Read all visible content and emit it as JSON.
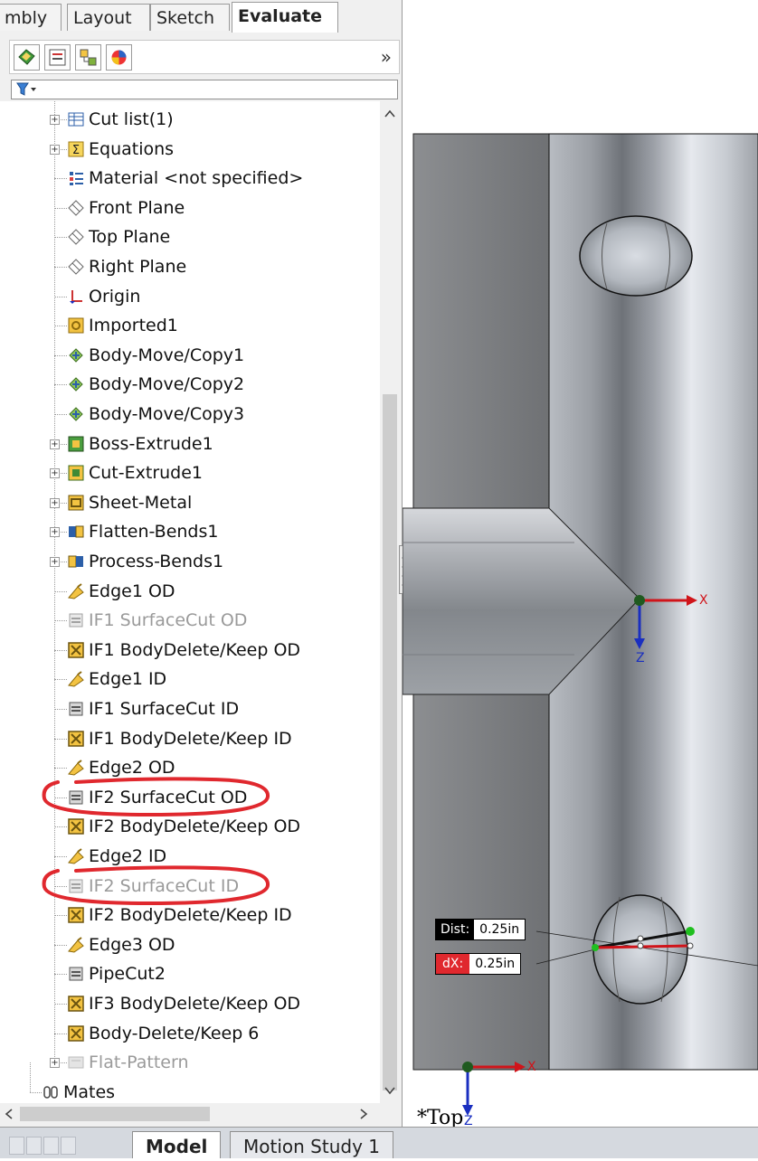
{
  "command_manager": {
    "tabs": [
      "mbly",
      "Layout",
      "Sketch",
      "Evaluate"
    ],
    "active_tab": "Evaluate",
    "expand_label": "»"
  },
  "feature_manager": {
    "toolbar_icons": [
      "feature-manager-tree-icon",
      "property-manager-icon",
      "configuration-manager-icon",
      "display-manager-icon"
    ],
    "tree": [
      {
        "label": "Cut list(1)",
        "icon": "cut-list-icon",
        "expandable": true,
        "dimmed": false
      },
      {
        "label": "Equations",
        "icon": "equations-icon",
        "expandable": true,
        "dimmed": false
      },
      {
        "label": "Material <not specified>",
        "icon": "material-icon",
        "expandable": false,
        "dimmed": false
      },
      {
        "label": "Front Plane",
        "icon": "plane-icon",
        "expandable": false,
        "dimmed": false
      },
      {
        "label": "Top Plane",
        "icon": "plane-icon",
        "expandable": false,
        "dimmed": false
      },
      {
        "label": "Right Plane",
        "icon": "plane-icon",
        "expandable": false,
        "dimmed": false
      },
      {
        "label": "Origin",
        "icon": "origin-icon",
        "expandable": false,
        "dimmed": false
      },
      {
        "label": "Imported1",
        "icon": "imported-body-icon",
        "expandable": false,
        "dimmed": false
      },
      {
        "label": "Body-Move/Copy1",
        "icon": "body-move-icon",
        "expandable": false,
        "dimmed": false
      },
      {
        "label": "Body-Move/Copy2",
        "icon": "body-move-icon",
        "expandable": false,
        "dimmed": false
      },
      {
        "label": "Body-Move/Copy3",
        "icon": "body-move-icon",
        "expandable": false,
        "dimmed": false
      },
      {
        "label": "Boss-Extrude1",
        "icon": "boss-extrude-icon",
        "expandable": true,
        "dimmed": false
      },
      {
        "label": "Cut-Extrude1",
        "icon": "cut-extrude-icon",
        "expandable": true,
        "dimmed": false
      },
      {
        "label": "Sheet-Metal",
        "icon": "sheet-metal-icon",
        "expandable": true,
        "dimmed": false
      },
      {
        "label": "Flatten-Bends1",
        "icon": "flatten-bends-icon",
        "expandable": true,
        "dimmed": false
      },
      {
        "label": "Process-Bends1",
        "icon": "process-bends-icon",
        "expandable": true,
        "dimmed": false
      },
      {
        "label": "Edge1 OD",
        "icon": "edge-icon",
        "expandable": false,
        "dimmed": false
      },
      {
        "label": "IF1 SurfaceCut OD",
        "icon": "surface-cut-icon",
        "expandable": false,
        "dimmed": true
      },
      {
        "label": "IF1 BodyDelete/Keep  OD",
        "icon": "body-delete-icon",
        "expandable": false,
        "dimmed": false
      },
      {
        "label": "Edge1 ID",
        "icon": "edge-icon",
        "expandable": false,
        "dimmed": false
      },
      {
        "label": "IF1 SurfaceCut ID",
        "icon": "surface-cut-icon",
        "expandable": false,
        "dimmed": false
      },
      {
        "label": "IF1 BodyDelete/Keep  ID",
        "icon": "body-delete-icon",
        "expandable": false,
        "dimmed": false
      },
      {
        "label": "Edge2 OD",
        "icon": "edge-icon",
        "expandable": false,
        "dimmed": false
      },
      {
        "label": "IF2 SurfaceCut OD",
        "icon": "surface-cut-icon",
        "expandable": false,
        "dimmed": false,
        "circled": true
      },
      {
        "label": "IF2 BodyDelete/Keep  OD",
        "icon": "body-delete-icon",
        "expandable": false,
        "dimmed": false
      },
      {
        "label": "Edge2 ID",
        "icon": "edge-icon",
        "expandable": false,
        "dimmed": false
      },
      {
        "label": "IF2 SurfaceCut ID",
        "icon": "surface-cut-icon",
        "expandable": false,
        "dimmed": true,
        "circled": true
      },
      {
        "label": "IF2 BodyDelete/Keep  ID",
        "icon": "body-delete-icon",
        "expandable": false,
        "dimmed": false
      },
      {
        "label": "Edge3 OD",
        "icon": "edge-icon",
        "expandable": false,
        "dimmed": false
      },
      {
        "label": "PipeCut2",
        "icon": "surface-cut-icon",
        "expandable": false,
        "dimmed": false
      },
      {
        "label": "IF3 BodyDelete/Keep  OD",
        "icon": "body-delete-icon",
        "expandable": false,
        "dimmed": false
      },
      {
        "label": "Body-Delete/Keep 6",
        "icon": "body-delete-icon",
        "expandable": false,
        "dimmed": false
      },
      {
        "label": "Flat-Pattern",
        "icon": "flat-pattern-icon",
        "expandable": true,
        "dimmed": true
      },
      {
        "label": "Mates",
        "icon": "mates-icon",
        "expandable": false,
        "dimmed": false
      }
    ]
  },
  "bottom_tabs": [
    "Model",
    "Motion Study 1"
  ],
  "active_bottom_tab": "Model",
  "graphics": {
    "view_name": "*Top",
    "dist_label": "Dist:",
    "dist_value": "0.25in",
    "dx_label": "dX:",
    "dx_value": "0.25in",
    "axis_x": "X",
    "axis_y": "Z"
  },
  "colors": {
    "annotation_red": "#e0282e",
    "axis_red": "#d0141a",
    "axis_blue": "#1a2fc0",
    "origin_green": "#1f5a1f"
  }
}
